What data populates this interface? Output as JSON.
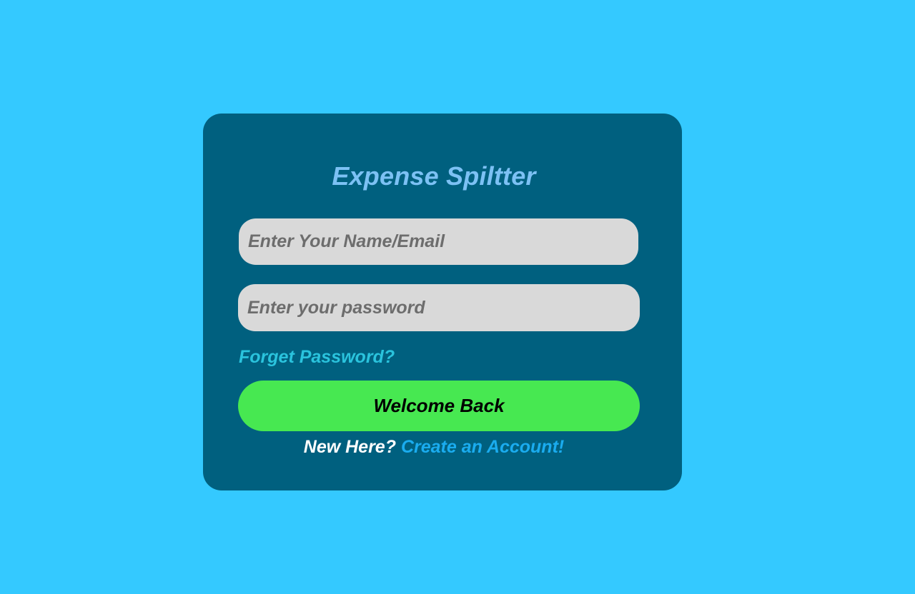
{
  "app": {
    "title": "Expense Spiltter"
  },
  "login_form": {
    "email_placeholder": "Enter Your Name/Email",
    "email_value": "",
    "password_placeholder": "Enter your password",
    "password_value": "",
    "forgot_password_label": "Forget Password?",
    "submit_label": "Welcome Back",
    "signup_prompt": "New Here?",
    "signup_link_label": "Create an Account!"
  },
  "colors": {
    "background": "#34c9ff",
    "card": "#00607f",
    "title": "#7cc1f4",
    "input_fill": "#d9d9d9",
    "forgot_link": "#2ac3dd",
    "submit_button": "#47e851",
    "signup_link": "#1aacef"
  }
}
